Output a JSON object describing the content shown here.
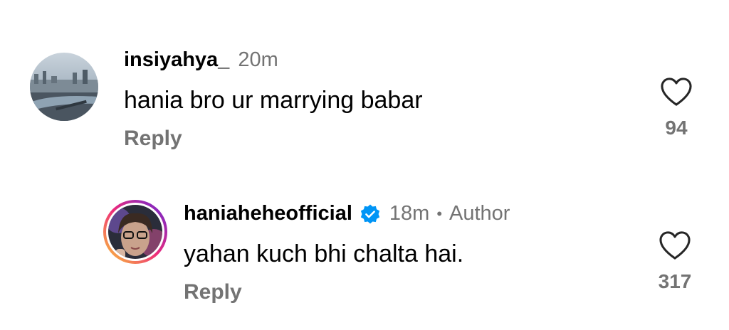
{
  "comments": [
    {
      "username": "insiyahya_",
      "time": "20m",
      "text": "hania bro ur marrying babar",
      "reply_label": "Reply",
      "likes": "94",
      "avatar_icon": "city-skyline-avatar"
    },
    {
      "username": "haniaheheofficial",
      "verified": true,
      "time": "18m",
      "separator": "•",
      "author_label": "Author",
      "text": "yahan kuch bhi chalta hai.",
      "reply_label": "Reply",
      "likes": "317",
      "avatar_icon": "profile-photo-avatar"
    }
  ],
  "colors": {
    "text_primary": "#000000",
    "text_secondary": "#737373",
    "verified_blue": "#0095F6",
    "story_ring_start": "#F9CE34",
    "story_ring_end": "#EE2A7B"
  },
  "icons": {
    "like": "heart-outline-icon",
    "verified": "verified-badge-icon"
  }
}
